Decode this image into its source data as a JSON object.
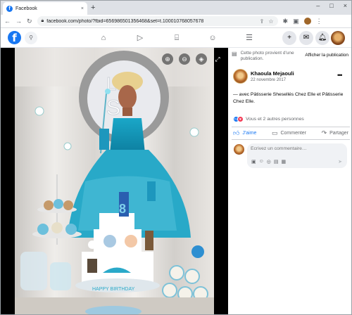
{
  "browser": {
    "tab_title": "Facebook",
    "tab_close": "×",
    "new_tab": "+",
    "url": "facebook.com/photo/?fbid=656986501356468&set=t.100010768057678",
    "window_controls": [
      "–",
      "□",
      "×"
    ]
  },
  "fb_header": {
    "logo": "f",
    "nav_icons": [
      "home-icon",
      "video-icon",
      "marketplace-icon",
      "groups-icon",
      "menu-icon"
    ],
    "right_icons": [
      "plus-icon",
      "messenger-icon",
      "notifications-icon"
    ],
    "brand_color": "#1877f2"
  },
  "post": {
    "info_text": "Cette photo provient d'une publication.",
    "info_button": "Afficher la publication",
    "author": "Khaoula Mejaouli",
    "date": "22 novembre 2017",
    "caption": "— avec Pâtisserie Shesellés Chez Elle et Pâtisserie Chez Elle.",
    "reactions_text": "Vous et 2 autres personnes",
    "actions": {
      "like": "J'aime",
      "comment": "Commenter",
      "share": "Partager"
    },
    "comment_placeholder": "Écrivez un commentaire…"
  }
}
